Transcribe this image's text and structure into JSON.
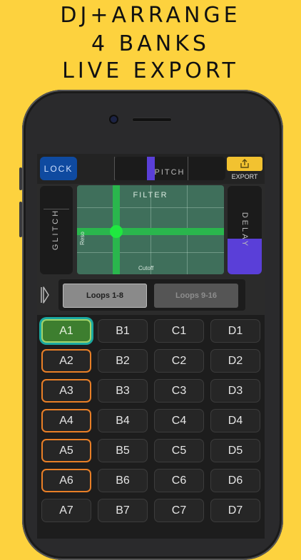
{
  "headline": {
    "line1": "DJ+ARRANGE",
    "line2": "4 BANKS",
    "line3": "LIVE EXPORT"
  },
  "app": {
    "lock_label": "LOCK",
    "pitch_label": "PITCH",
    "export_label": "EXPORT",
    "export_icon": "share-icon",
    "glitch_label": "GLITCH",
    "delay_label": "DELAY",
    "delay_level": 0.4,
    "filter": {
      "title": "FILTER",
      "x_label": "Cutoff",
      "y_label": "Reso"
    },
    "mode_icon": "deck-icon",
    "loops_tabs": [
      "Loops 1-8",
      "Loops 9-16"
    ],
    "active_tab": 0,
    "pads": [
      [
        "A1",
        "B1",
        "C1",
        "D1"
      ],
      [
        "A2",
        "B2",
        "C2",
        "D2"
      ],
      [
        "A3",
        "B3",
        "C3",
        "D3"
      ],
      [
        "A4",
        "B4",
        "C4",
        "D4"
      ],
      [
        "A5",
        "B5",
        "C5",
        "D5"
      ],
      [
        "A6",
        "B6",
        "C6",
        "D6"
      ],
      [
        "A7",
        "B7",
        "C7",
        "D7"
      ]
    ],
    "active_pad": "A1",
    "colors": {
      "background": "#fdd23e",
      "lock": "#0f4aa0",
      "accent_purple": "#5a3fd8",
      "filter_green": "#2ab64d",
      "pad_orange": "#e97f27",
      "export_yellow": "#f2c230"
    }
  }
}
